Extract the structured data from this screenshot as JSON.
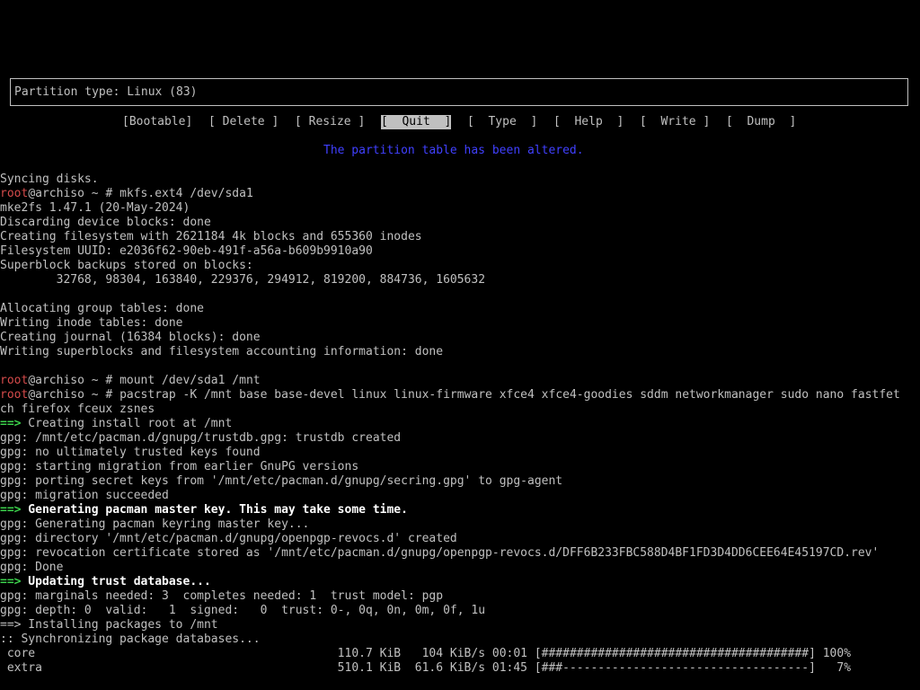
{
  "cfdisk": {
    "partition_type_label": "Partition type: Linux (83)",
    "menu": [
      {
        "label": "[Bootable]"
      },
      {
        "label": "[ Delete ]"
      },
      {
        "label": "[ Resize ]"
      },
      {
        "label": "[  Quit  ]",
        "selected": true
      },
      {
        "label": "[  Type  ]"
      },
      {
        "label": "[  Help  ]"
      },
      {
        "label": "[  Write ]"
      },
      {
        "label": "[  Dump  ]"
      }
    ],
    "alert": "The partition table has been altered."
  },
  "terminal": {
    "prompt_user": "root",
    "prompt_rest": "@archiso ~ # ",
    "lines": [
      {
        "text": "Syncing disks."
      },
      {
        "prompt": true,
        "cmd": "mkfs.ext4 /dev/sda1"
      },
      {
        "text": "mke2fs 1.47.1 (20-May-2024)"
      },
      {
        "text": "Discarding device blocks: done"
      },
      {
        "text": "Creating filesystem with 2621184 4k blocks and 655360 inodes"
      },
      {
        "text": "Filesystem UUID: e2036f62-90eb-491f-a56a-b609b9910a90"
      },
      {
        "text": "Superblock backups stored on blocks:"
      },
      {
        "text": "        32768, 98304, 163840, 229376, 294912, 819200, 884736, 1605632"
      },
      {
        "text": ""
      },
      {
        "text": "Allocating group tables: done"
      },
      {
        "text": "Writing inode tables: done"
      },
      {
        "text": "Creating journal (16384 blocks): done"
      },
      {
        "text": "Writing superblocks and filesystem accounting information: done"
      },
      {
        "text": ""
      },
      {
        "prompt": true,
        "cmd": "mount /dev/sda1 /mnt"
      },
      {
        "prompt": true,
        "cmd": "pacstrap -K /mnt base base-devel linux linux-firmware xfce4 xfce4-goodies sddm networkmanager sudo nano fastfet"
      },
      {
        "text": "ch firefox fceux zsnes"
      },
      {
        "arrow": "==>",
        "text": " Creating install root at /mnt"
      },
      {
        "text": "gpg: /mnt/etc/pacman.d/gnupg/trustdb.gpg: trustdb created"
      },
      {
        "text": "gpg: no ultimately trusted keys found"
      },
      {
        "text": "gpg: starting migration from earlier GnuPG versions"
      },
      {
        "text": "gpg: porting secret keys from '/mnt/etc/pacman.d/gnupg/secring.gpg' to gpg-agent"
      },
      {
        "text": "gpg: migration succeeded"
      },
      {
        "arrow": "==>",
        "bold": true,
        "text": " Generating pacman master key. This may take some time."
      },
      {
        "text": "gpg: Generating pacman keyring master key..."
      },
      {
        "text": "gpg: directory '/mnt/etc/pacman.d/gnupg/openpgp-revocs.d' created"
      },
      {
        "text": "gpg: revocation certificate stored as '/mnt/etc/pacman.d/gnupg/openpgp-revocs.d/DFF6B233FBC588D4BF1FD3D4DD6CEE64E45197CD.rev'"
      },
      {
        "text": "gpg: Done"
      },
      {
        "arrow": "==>",
        "bold": true,
        "text": " Updating trust database..."
      },
      {
        "text": "gpg: marginals needed: 3  completes needed: 1  trust model: pgp"
      },
      {
        "text": "gpg: depth: 0  valid:   1  signed:   0  trust: 0-, 0q, 0n, 0m, 0f, 1u"
      },
      {
        "text": "==> Installing packages to /mnt"
      },
      {
        "text": ":: Synchronizing package databases..."
      },
      {
        "text": " core                                           110.7 KiB   104 KiB/s 00:01 [######################################] 100%"
      },
      {
        "text": " extra                                          510.1 KiB  61.6 KiB/s 01:45 [###-----------------------------------]   7%"
      }
    ]
  },
  "colors": {
    "background": "#000000",
    "foreground": "#c0c0c0",
    "prompt_user": "#d54b4b",
    "arrow": "#3bd14b",
    "alert": "#4040ff"
  }
}
